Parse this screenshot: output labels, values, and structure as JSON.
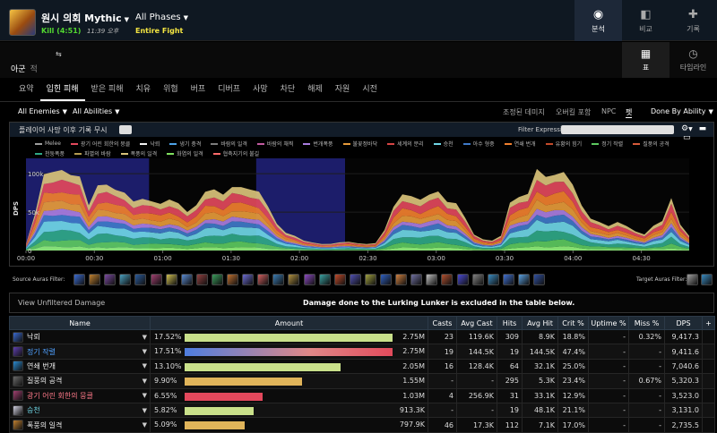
{
  "header": {
    "title": "원시 의회 Mythic",
    "kill": "Kill (4:51)",
    "time": "11:39 오후",
    "phases": "All Phases",
    "fight": "Entire Fight",
    "nav": [
      {
        "label": "분석",
        "icon": "eye-icon",
        "active": true
      },
      {
        "label": "비교",
        "icon": "compare-icon",
        "active": false
      },
      {
        "label": "기록",
        "icon": "puzzle-icon",
        "active": false
      }
    ]
  },
  "subbar": {
    "primary": "아군",
    "secondary": "적",
    "arrow": "⇆",
    "views": [
      {
        "label": "표",
        "icon": "grid-icon",
        "active": true
      },
      {
        "label": "타임라인",
        "icon": "clock-icon",
        "active": false
      }
    ]
  },
  "tabs": [
    "요약",
    "입힌 피해",
    "받은 피해",
    "치유",
    "위협",
    "버프",
    "디버프",
    "사망",
    "차단",
    "해제",
    "자원",
    "시전"
  ],
  "active_tab": 1,
  "filters": {
    "enemies": "All Enemies",
    "abilities": "All Abilities",
    "toggles": [
      "조정된 데미지",
      "오버킬 포함",
      "NPC",
      "펫"
    ],
    "done_by": "Done By Ability"
  },
  "chart_panel": {
    "selection_label": "플레이어 사망 이후 기록 무시",
    "filter_label": "Filter Expression:",
    "filter_value": ""
  },
  "chart_data": {
    "type": "area",
    "title": "",
    "ylabel": "DPS",
    "y_ticks": [
      "100k",
      "50k",
      "0"
    ],
    "x_ticks": [
      "00:00",
      "00:30",
      "01:00",
      "01:30",
      "02:00",
      "02:30",
      "03:00",
      "03:30",
      "04:00",
      "04:30"
    ],
    "x_range_seconds": [
      0,
      291
    ],
    "highlights_seconds": [
      [
        0,
        54
      ],
      [
        101,
        140
      ]
    ],
    "legend": [
      {
        "name": "Melee",
        "color": "#9e9e9e"
      },
      {
        "name": "광기 어린 회한의 뭉클",
        "color": "#e2485c"
      },
      {
        "name": "낙뢰",
        "color": "#f2f2f2"
      },
      {
        "name": "냉기 충격",
        "color": "#4ea3e8"
      },
      {
        "name": "바람의 일격",
        "color": "#7d7d7d"
      },
      {
        "name": "바람의 채찍",
        "color": "#c25aa0"
      },
      {
        "name": "번개폭풍",
        "color": "#a97de0"
      },
      {
        "name": "불꽃정바닥",
        "color": "#e59a3a"
      },
      {
        "name": "세계의 분리",
        "color": "#d64444"
      },
      {
        "name": "승천",
        "color": "#6fd6e6"
      },
      {
        "name": "아수 형중",
        "color": "#3f7ac9"
      },
      {
        "name": "연쇄 번개",
        "color": "#f07f2e"
      },
      {
        "name": "유황의 힘기",
        "color": "#c24a2a"
      },
      {
        "name": "정기 작렬",
        "color": "#5cc95f"
      },
      {
        "name": "질풍의 공격",
        "color": "#d65a3a"
      },
      {
        "name": "천둥폭풍",
        "color": "#2fa887"
      },
      {
        "name": "파멸의 바람",
        "color": "#b59b52"
      },
      {
        "name": "폭풍의 일격",
        "color": "#d9c27a"
      },
      {
        "name": "화염의 일격",
        "color": "#7fe05f"
      },
      {
        "name": "협축지기의 불길",
        "color": "#ff6a6a"
      }
    ],
    "series_total_k": [
      8,
      45,
      95,
      96,
      98,
      95,
      92,
      55,
      80,
      82,
      75,
      72,
      60,
      63,
      62,
      58,
      62,
      58,
      48,
      56,
      73,
      75,
      68,
      80,
      79,
      74,
      72,
      55,
      33,
      22,
      18,
      12,
      10,
      8,
      8,
      10,
      11,
      9,
      8,
      9,
      25,
      55,
      70,
      66,
      62,
      70,
      73,
      60,
      58,
      40,
      20,
      14,
      12,
      18,
      60,
      66,
      70,
      100,
      90,
      95,
      98,
      80,
      55,
      40,
      35,
      30,
      35,
      30,
      24,
      20,
      30,
      36,
      66,
      32,
      18
    ]
  },
  "auras": {
    "source_label": "Source Auras Filter:",
    "target_label": "Target Auras Filter:",
    "source_icons": [
      "aura-1-icon",
      "aura-2-icon",
      "aura-3-icon",
      "aura-4-icon",
      "aura-5-icon",
      "aura-6-icon",
      "aura-7-icon",
      "aura-8-icon",
      "aura-9-icon",
      "aura-10-icon",
      "aura-11-icon",
      "aura-12-icon",
      "aura-13-icon",
      "aura-14-icon",
      "aura-15-icon",
      "aura-16-icon",
      "aura-17-icon",
      "aura-18-icon",
      "aura-19-icon",
      "aura-20-icon",
      "aura-21-icon",
      "aura-22-icon",
      "aura-23-icon",
      "aura-24-icon",
      "aura-25-icon",
      "aura-26-icon",
      "aura-27-icon",
      "aura-28-icon",
      "aura-29-icon",
      "aura-30-icon",
      "aura-31-icon"
    ],
    "target_icons": [
      "target-aura-1-icon",
      "target-aura-2-icon"
    ]
  },
  "notice": {
    "unfiltered": "View Unfiltered Damage",
    "text": "Damage done to the Lurking Lunker is excluded in the table below."
  },
  "table": {
    "headers": [
      "Name",
      "Amount",
      "Casts",
      "Avg Cast",
      "Hits",
      "Avg Hit",
      "Crit %",
      "Uptime %",
      "Miss %",
      "DPS",
      "+"
    ],
    "rows": [
      {
        "name": "낙뢰",
        "pct": "17.52%",
        "fraction": 1.0,
        "amount": "2.75M",
        "casts": "23",
        "avg_cast": "119.6K",
        "hits": "309",
        "avg_hit": "8.9K",
        "crit": "18.8%",
        "uptime": "-",
        "miss": "0.32%",
        "dps": "9,417.3",
        "bar": "#c9e08a",
        "name_color": "#f0f0f0",
        "icon": "#3a6ad0"
      },
      {
        "name": "정기 작렬",
        "pct": "17.51%",
        "fraction": 1.0,
        "amount": "2.75M",
        "casts": "19",
        "avg_cast": "144.5K",
        "hits": "19",
        "avg_hit": "144.5K",
        "crit": "47.4%",
        "uptime": "-",
        "miss": "-",
        "dps": "9,411.6",
        "bar": "linear-gradient(90deg,#4e7ee0,#e08888 60%,#e24b5c)",
        "name_color": "#4fa0ff",
        "icon": "#6040b0"
      },
      {
        "name": "연쇄 번개",
        "pct": "13.10%",
        "fraction": 0.748,
        "amount": "2.05M",
        "casts": "16",
        "avg_cast": "128.4K",
        "hits": "64",
        "avg_hit": "32.1K",
        "crit": "25.0%",
        "uptime": "-",
        "miss": "-",
        "dps": "7,040.6",
        "bar": "#c9e08a",
        "name_color": "#f0f0f0",
        "icon": "#2a8ad0"
      },
      {
        "name": "질풍의 공격",
        "pct": "9.90%",
        "fraction": 0.565,
        "amount": "1.55M",
        "casts": "-",
        "avg_cast": "-",
        "hits": "295",
        "avg_hit": "5.3K",
        "crit": "23.4%",
        "uptime": "-",
        "miss": "0.67%",
        "dps": "5,320.3",
        "bar": "#e0b45a",
        "name_color": "#f0f0f0",
        "icon": "#6a6a6a"
      },
      {
        "name": "광기 어린 회한의 뭉클",
        "pct": "6.55%",
        "fraction": 0.374,
        "amount": "1.03M",
        "casts": "4",
        "avg_cast": "256.9K",
        "hits": "31",
        "avg_hit": "33.1K",
        "crit": "12.9%",
        "uptime": "-",
        "miss": "-",
        "dps": "3,523.0",
        "bar": "#e2485c",
        "name_color": "#ff7a8a",
        "icon": "#a04070"
      },
      {
        "name": "승천",
        "pct": "5.82%",
        "fraction": 0.332,
        "amount": "913.3K",
        "casts": "-",
        "avg_cast": "-",
        "hits": "19",
        "avg_hit": "48.1K",
        "crit": "21.1%",
        "uptime": "-",
        "miss": "-",
        "dps": "3,131.0",
        "bar": "#c9e08a",
        "name_color": "#6fd6e6",
        "icon": "#d0d0e0"
      },
      {
        "name": "폭풍의 일격",
        "pct": "5.09%",
        "fraction": 0.29,
        "amount": "797.9K",
        "casts": "46",
        "avg_cast": "17.3K",
        "hits": "112",
        "avg_hit": "7.1K",
        "crit": "17.0%",
        "uptime": "-",
        "miss": "-",
        "dps": "2,735.5",
        "bar": "#e0b45a",
        "name_color": "#f0f0f0",
        "icon": "#c08030"
      }
    ]
  }
}
